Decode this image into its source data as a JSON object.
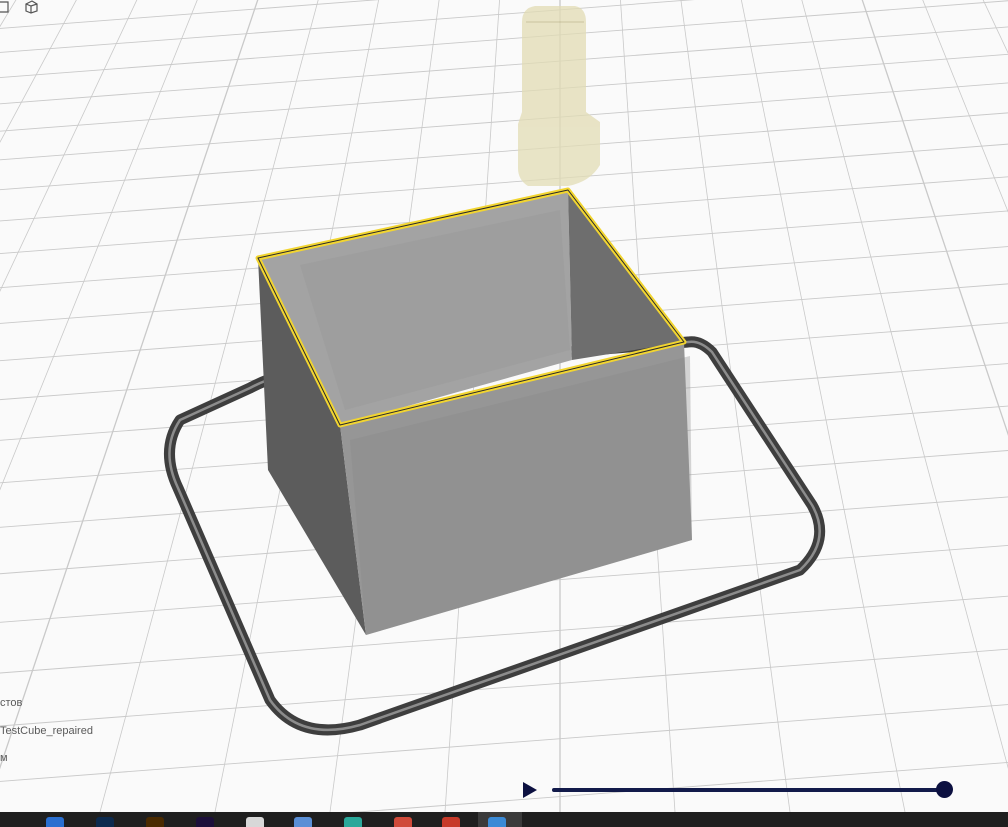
{
  "viewport": {
    "object_count_label": "стов",
    "object_name": "TestCube_repaired",
    "unit_label": "м"
  },
  "colors": {
    "background": "#fafafa",
    "grid_line": "#c9c9c9",
    "cube_face": "#9a9a9a",
    "top_layer": "#f2d530",
    "skirt": "#4a4a4a",
    "nozzle": "#e2dcb4",
    "slider_track": "#121a4a",
    "slider_handle": "#0c1040"
  },
  "layer_view": {
    "position": 1.0
  },
  "taskbar": {
    "apps": [
      {
        "name": "app-1",
        "color": "#2a6fd0"
      },
      {
        "name": "photoshop",
        "color": "#0c2a4e"
      },
      {
        "name": "illustrator",
        "color": "#4a2a00"
      },
      {
        "name": "premiere",
        "color": "#1c0f3a"
      },
      {
        "name": "chrome",
        "color": "#d8d8d8"
      },
      {
        "name": "app-6",
        "color": "#5a8fd6"
      },
      {
        "name": "app-7",
        "color": "#2aa89a"
      },
      {
        "name": "app-8",
        "color": "#d04a3a"
      },
      {
        "name": "app-9",
        "color": "#c73a2a"
      },
      {
        "name": "cura",
        "color": "#3a8ad6"
      }
    ]
  }
}
